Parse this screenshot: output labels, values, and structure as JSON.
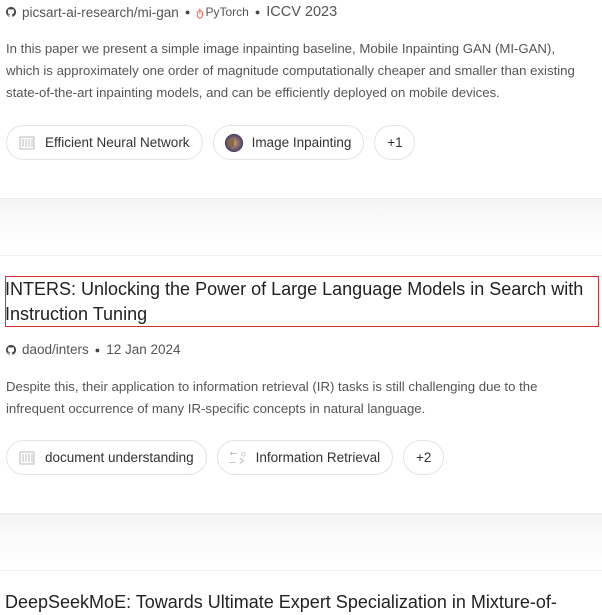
{
  "paper1": {
    "repo": "picsart-ai-research/mi-gan",
    "framework": "PyTorch",
    "venue": "ICCV 2023",
    "abstract": "In this paper we present a simple image inpainting baseline, Mobile Inpainting GAN (MI-GAN), which is approximately one order of magnitude computationally cheaper and smaller than existing state-of-the-art inpainting models, and can be efficiently deployed on mobile devices.",
    "tags": [
      "Efficient Neural Network",
      "Image Inpainting"
    ],
    "more": "+1"
  },
  "paper2": {
    "title": "INTERS: Unlocking the Power of Large Language Models in Search with Instruction Tuning",
    "repo": "daod/inters",
    "date": "12 Jan 2024",
    "abstract": "Despite this, their application to information retrieval (IR) tasks is still challenging due to the infrequent occurrence of many IR-specific concepts in natural language.",
    "tags": [
      "document understanding",
      "Information Retrieval"
    ],
    "more": "+2"
  },
  "paper3": {
    "title": "DeepSeekMoE: Towards Ultimate Expert Specialization in Mixture-of-"
  },
  "colors": {
    "highlight_border": "#d32f2f",
    "pytorch": "#ee4c2c"
  },
  "icons": [
    "github-icon",
    "pytorch-icon",
    "paper-icon",
    "image-thumbnail-icon",
    "retrieval-icon"
  ]
}
